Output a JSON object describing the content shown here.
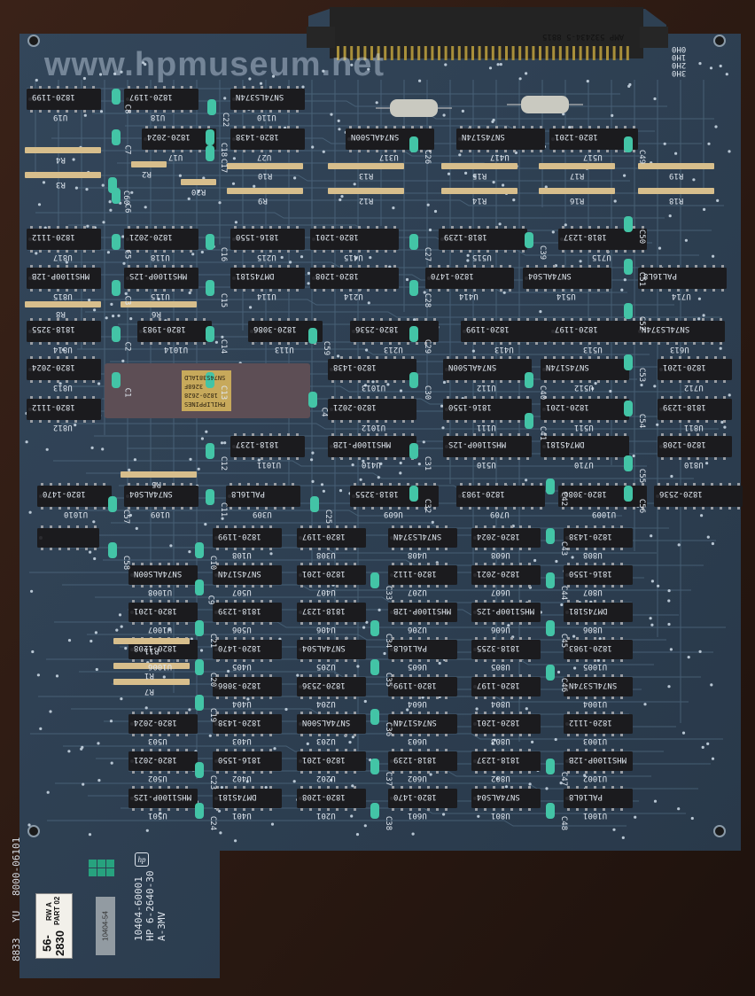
{
  "photo": {
    "watermark": "www.hpmuseum.net",
    "connector_label": "AMP 532434-5 8815",
    "top_right_labels": [
      "0H0",
      "1H0",
      "2H0",
      "3H0"
    ],
    "left_edge_text": [
      "8833",
      "YU",
      "8000-06101"
    ],
    "bottom_labels": [
      "10404-60001",
      "HP 6-2640-30",
      "A-3MV"
    ],
    "sticker_lines": [
      "56-2830",
      "RW A PART 02"
    ],
    "handwritten_note": "10404-54",
    "hp_logo": "hp",
    "main_chip": [
      "PHILIPPINES",
      "1820-2628",
      "3268F",
      "SN74S381ALD"
    ],
    "resistor_labels": [
      "R4",
      "R3",
      "R2",
      "R20",
      "R10",
      "R13",
      "R15",
      "R17",
      "R19",
      "R9",
      "R12",
      "R14",
      "R16",
      "R18",
      "R6",
      "R8",
      "R5",
      "R11",
      "R1",
      "R7"
    ],
    "unit_labels_top": [
      "U19",
      "U18",
      "U110",
      "U17",
      "U27",
      "U317",
      "U417",
      "U517",
      "U817",
      "U118",
      "U215",
      "U415",
      "U515",
      "U715",
      "U815",
      "U115",
      "U114",
      "U214",
      "U414",
      "U514",
      "U714",
      "U814",
      "U1014",
      "U113",
      "U213",
      "U413",
      "U513",
      "U613",
      "U813",
      "U1013",
      "U112",
      "U512",
      "U712",
      "U812",
      "U1012",
      "U111",
      "U511",
      "U811",
      "U1011",
      "U410",
      "U510",
      "U710",
      "U810",
      "U1010",
      "U109",
      "U309",
      "U609",
      "U709",
      "U1009"
    ],
    "unit_labels_grid": [
      "U108",
      "U308",
      "U408",
      "U608",
      "U808",
      "U1008",
      "U507",
      "U407",
      "U207",
      "U607",
      "U807",
      "U1007",
      "U506",
      "U406",
      "U206",
      "U606",
      "U806",
      "U1006",
      "U405",
      "U205",
      "U605",
      "U805",
      "U1005",
      "U404",
      "U204",
      "U604",
      "U804",
      "U1004",
      "U503",
      "U403",
      "U203",
      "U603",
      "U803",
      "U1003",
      "U502",
      "U402",
      "U202",
      "U602",
      "U802",
      "U1002",
      "U501",
      "U401",
      "U201",
      "U601",
      "U801",
      "U1001"
    ],
    "capacitor_labels": [
      "C8",
      "C22",
      "C7",
      "C6",
      "C5",
      "C3",
      "C2",
      "C1",
      "C4",
      "C18",
      "C17",
      "C16",
      "C15",
      "C14",
      "C13",
      "C12",
      "C11",
      "C10",
      "C9",
      "C21",
      "C20",
      "C19",
      "C23",
      "C24",
      "C25",
      "C26",
      "C27",
      "C28",
      "C29",
      "C30",
      "C31",
      "C32",
      "C33",
      "C34",
      "C35",
      "C36",
      "C37",
      "C38",
      "C39",
      "C40",
      "C41",
      "C42",
      "C43",
      "C44",
      "C45",
      "C46",
      "C47",
      "C48",
      "C49",
      "C50",
      "C51",
      "C52",
      "C53",
      "C54",
      "C55",
      "C56",
      "C57",
      "C58",
      "C59",
      "C60"
    ],
    "chip_part_markings": [
      "1820-1199",
      "1820-1197",
      "SN74LS374N",
      "1820-2024",
      "1820-1438",
      "SN74ALS00N",
      "SN74S174N",
      "1820-1201",
      "1820-1112",
      "1820-2021",
      "1816-1550",
      "1820-1201",
      "1818-1239",
      "1818-1237",
      "MHS1100P-12B",
      "MHS1100P-12S",
      "DM74S181",
      "1820-1208",
      "1820-1470",
      "SN74ALS04",
      "PAL16L8",
      "1818-3255",
      "1820-1983",
      "1820-3086",
      "1820-2536"
    ]
  }
}
